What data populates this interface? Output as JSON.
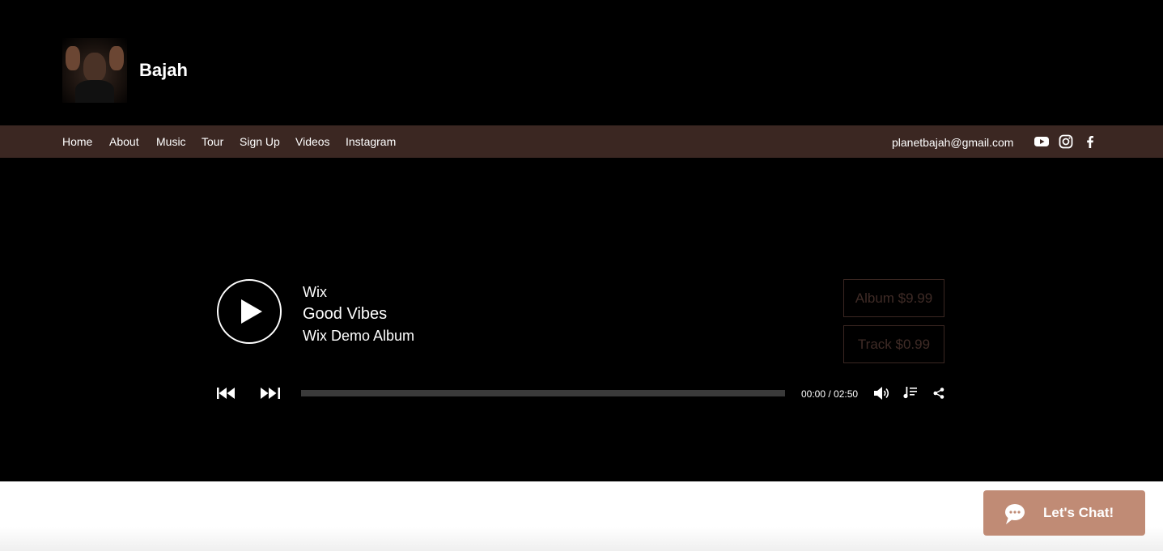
{
  "header": {
    "site_name": "Bajah"
  },
  "nav": {
    "items": [
      "Home",
      "About",
      "Music",
      "Tour",
      "Sign Up",
      "Videos",
      "Instagram"
    ],
    "email": "planetbajah@gmail.com",
    "social_icons": [
      "youtube-icon",
      "instagram-icon",
      "facebook-icon"
    ]
  },
  "player": {
    "artist": "Wix",
    "track_title": "Good Vibes",
    "album_title": "Wix Demo Album",
    "buy_album_label": "Album $9.99",
    "buy_track_label": "Track $0.99",
    "time_display": "00:00 / 02:50",
    "progress": 0,
    "icons": [
      "play-icon",
      "previous-icon",
      "next-icon",
      "volume-icon",
      "playlist-icon",
      "share-icon"
    ]
  },
  "chat": {
    "label": "Let's Chat!"
  },
  "colors": {
    "nav_background": "#3b2722",
    "chat_button": "#c08b75",
    "page_background": "#000000"
  }
}
